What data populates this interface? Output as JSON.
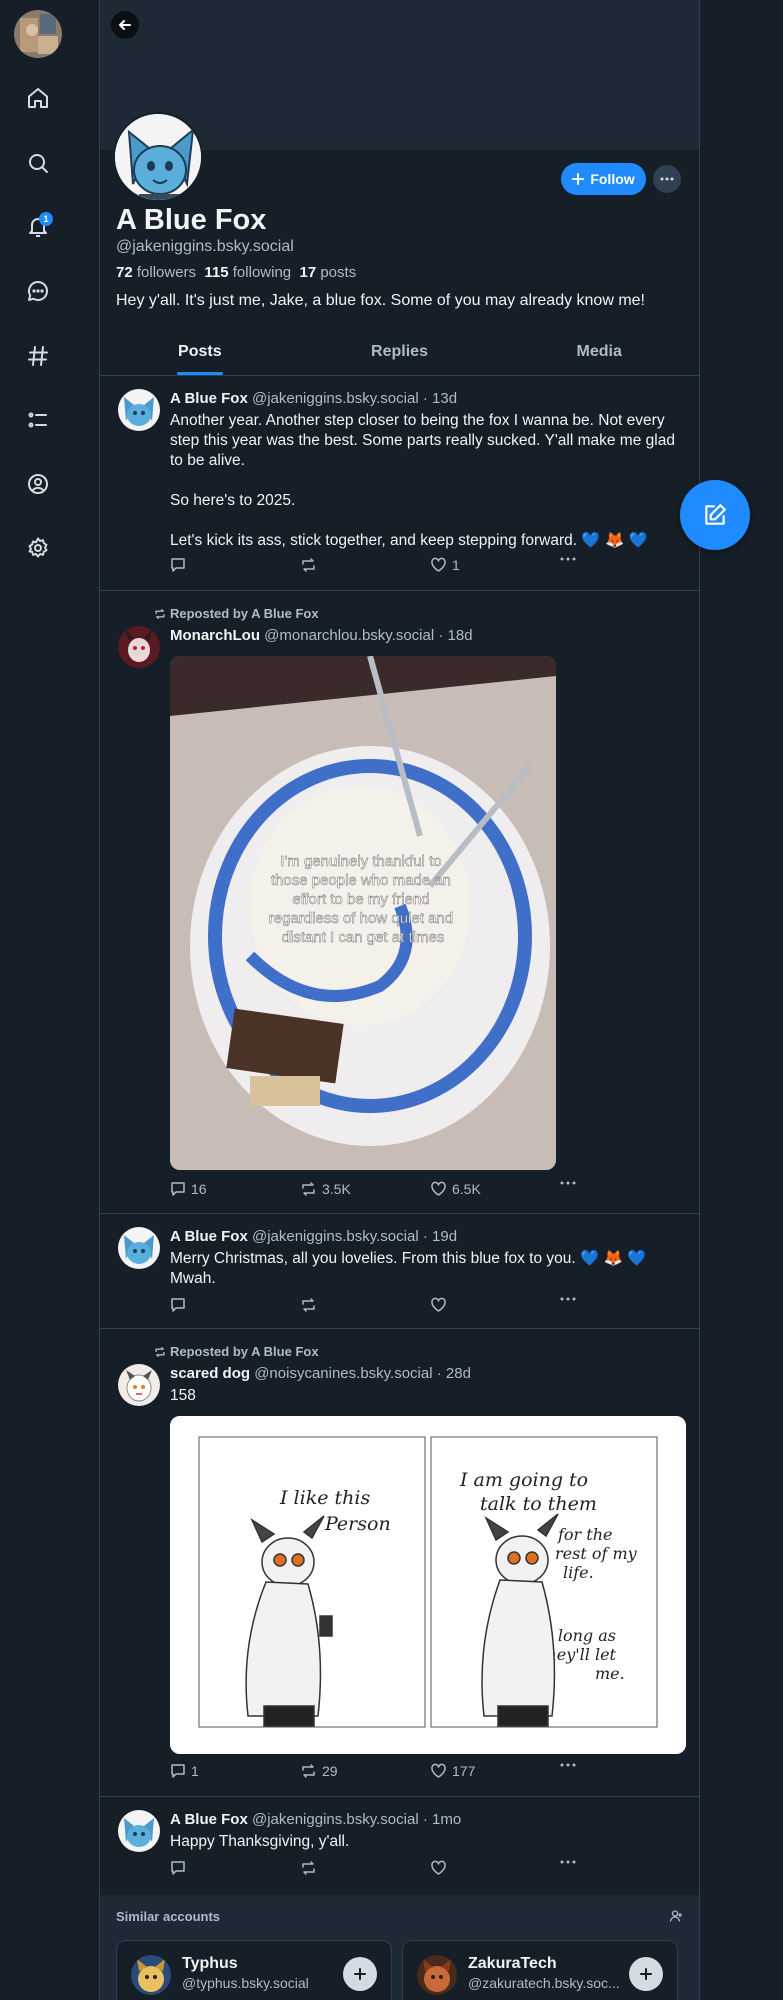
{
  "nav": {
    "notifications_badge": "1",
    "items": [
      "home-icon",
      "search-icon",
      "bell-icon",
      "chat-icon",
      "hashtag-icon",
      "list-icon",
      "profile-icon",
      "gear-icon"
    ]
  },
  "profile": {
    "display_name": "A Blue Fox",
    "handle": "@jakeniggins.bsky.social",
    "followers_count": "72",
    "followers_label": "followers",
    "following_count": "115",
    "following_label": "following",
    "posts_count": "17",
    "posts_label": "posts",
    "bio": "Hey y'all. It's just me, Jake, a blue fox. Some of you may already know me!",
    "follow_label": "Follow"
  },
  "tabs": [
    {
      "label": "Posts",
      "active": true
    },
    {
      "label": "Replies",
      "active": false
    },
    {
      "label": "Media",
      "active": false
    }
  ],
  "posts": [
    {
      "author": "A Blue Fox",
      "handle": "@jakeniggins.bsky.social",
      "time": "13d",
      "text_lines": [
        "Another year. Another step closer to being the fox I wanna be. Not every step this year was the best. Some parts really sucked. Y'all make me glad to be alive.",
        "So here's to 2025.",
        "Let's kick its ass, stick together, and keep stepping forward. 💙 🦊 💙"
      ],
      "replies": "",
      "reposts": "",
      "likes": "1"
    },
    {
      "repost_by": "Reposted by A Blue Fox",
      "author": "MonarchLou",
      "handle": "@monarchlou.bsky.social",
      "time": "18d",
      "image_caption": "I'm genuinely thankful to those people who made an effort to be my friend regardless of how quiet and distant I can get at times",
      "replies": "16",
      "reposts": "3.5K",
      "likes": "6.5K"
    },
    {
      "author": "A Blue Fox",
      "handle": "@jakeniggins.bsky.social",
      "time": "19d",
      "text": "Merry Christmas, all you lovelies. From this blue fox to you. 💙 🦊 💙 Mwah.",
      "replies": "",
      "reposts": "",
      "likes": ""
    },
    {
      "repost_by": "Reposted by A Blue Fox",
      "author": "scared dog",
      "handle": "@noisycanines.bsky.social",
      "time": "28d",
      "text": "158",
      "comic_left": [
        "I like this",
        "Person"
      ],
      "comic_right": [
        "I am going to",
        "talk to them",
        "for the",
        "rest of my",
        "life.",
        "As long as",
        "they'll let",
        "me."
      ],
      "replies": "1",
      "reposts": "29",
      "likes": "177"
    },
    {
      "author": "A Blue Fox",
      "handle": "@jakeniggins.bsky.social",
      "time": "1mo",
      "text": "Happy Thanksgiving, y'all.",
      "replies": "",
      "reposts": "",
      "likes": ""
    }
  ],
  "similar": {
    "title": "Similar accounts",
    "accounts": [
      {
        "name": "Typhus",
        "handle": "@typhus.bsky.social"
      },
      {
        "name": "ZakuraTech",
        "handle": "@zakuratech.bsky.soc..."
      }
    ]
  },
  "colors": {
    "background": "#161e27",
    "accent": "#208bfe",
    "border": "#2e4052",
    "muted_text": "#aebbc9"
  }
}
